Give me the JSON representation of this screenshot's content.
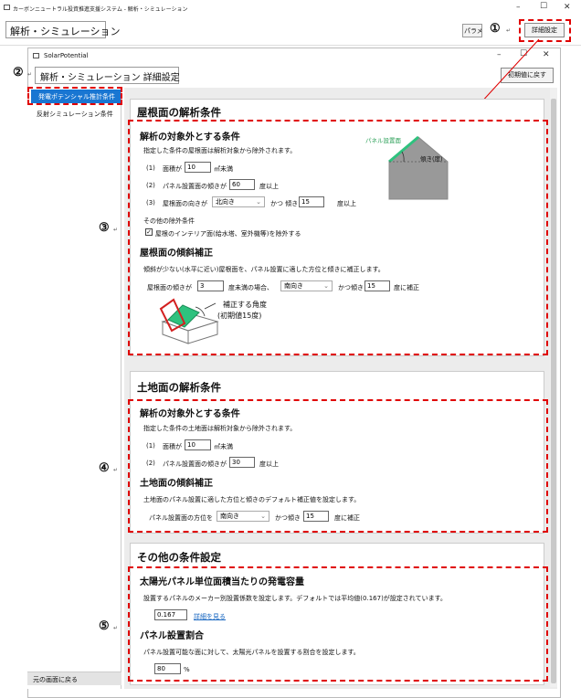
{
  "outer": {
    "title": "カーボンニュートラル投資推進支援システム - 解析・シミュレーション",
    "heading": "解析・シミュレーション",
    "param_button": "パラメータ",
    "detail_button": "詳細設定",
    "win_min": "–",
    "win_max": "☐",
    "win_close": "✕"
  },
  "inner": {
    "title": "SolarPotential",
    "heading": "解析・シミュレーション 詳細設定",
    "reset_button": "初期値に戻す",
    "win_min": "–",
    "win_max": "☐",
    "win_close": "✕"
  },
  "callouts": {
    "c1": "①",
    "c2": "②",
    "c3": "③",
    "c4": "④",
    "c5": "⑤",
    "ret": "↵"
  },
  "sidebar": {
    "items": [
      "発電ポテンシャル推計条件",
      "反射シミュレーション条件"
    ],
    "back": "元の画面に戻る"
  },
  "roof": {
    "title": "屋根面の解析条件",
    "exclude_title": "解析の対象外とする条件",
    "exclude_desc": "指定した条件の屋根面は解析対象から除外されます。",
    "area_num": "(1)",
    "area_label": "面積が",
    "area_value": "10",
    "area_unit": "㎡未満",
    "tilt_num": "(2)",
    "tilt_label": "パネル設置面の傾きが",
    "tilt_value": "60",
    "tilt_unit": "度以上",
    "dir_num": "(3)",
    "dir_label": "屋根面の向きが",
    "dir_value": "北向き",
    "dir_and": "かつ 傾き",
    "dir_tilt": "15",
    "dir_unit": "度以上",
    "diagram_panel": "パネル設置面",
    "diagram_angle": "傾き(度)",
    "other_title": "その他の除外条件",
    "other_check": "屋根のインテリア面(給水塔、室外機等)を除外する",
    "corr_title": "屋根面の傾斜補正",
    "corr_desc": "傾斜が少ない(水平に近い)屋根面を、パネル設置に適した方位と傾きに補正します。",
    "corr_label": "屋根面の傾きが",
    "corr_value": "3",
    "corr_mid": "度未満の場合、",
    "corr_dir": "南向き",
    "corr_and": "かつ傾き",
    "corr_tilt": "15",
    "corr_unit": "度に補正",
    "corr_note1": "補正する角度",
    "corr_note2": "(初期値15度)"
  },
  "land": {
    "title": "土地面の解析条件",
    "exclude_title": "解析の対象外とする条件",
    "exclude_desc": "指定した条件の土地面は解析対象から除外されます。",
    "area_num": "(1)",
    "area_label": "面積が",
    "area_value": "10",
    "area_unit": "㎡未満",
    "tilt_num": "(2)",
    "tilt_label": "パネル設置面の傾きが",
    "tilt_value": "30",
    "tilt_unit": "度以上",
    "corr_title": "土地面の傾斜補正",
    "corr_desc": "土地面のパネル設置に適した方位と傾きのデフォルト補正値を設定します。",
    "corr_label": "パネル設置面の方位を",
    "corr_dir": "南向き",
    "corr_and": "かつ傾き",
    "corr_tilt": "15",
    "corr_unit": "度に補正"
  },
  "other": {
    "title": "その他の条件設定",
    "cap_title": "太陽光パネル単位面積当たりの発電容量",
    "cap_desc": "設置するパネルのメーカー別設置係数を設定します。デフォルトでは平均値(0.167)が設定されています。",
    "cap_value": "0.167",
    "cap_link": "詳細を見る",
    "ratio_title": "パネル設置割合",
    "ratio_desc": "パネル設置可能な面に対して、太陽光パネルを設置する割合を設定します。",
    "ratio_value": "80",
    "ratio_unit": "%"
  },
  "colors": {
    "accent": "#1976d2",
    "callout_red": "#e00000",
    "panel_green": "#2ec27e"
  }
}
